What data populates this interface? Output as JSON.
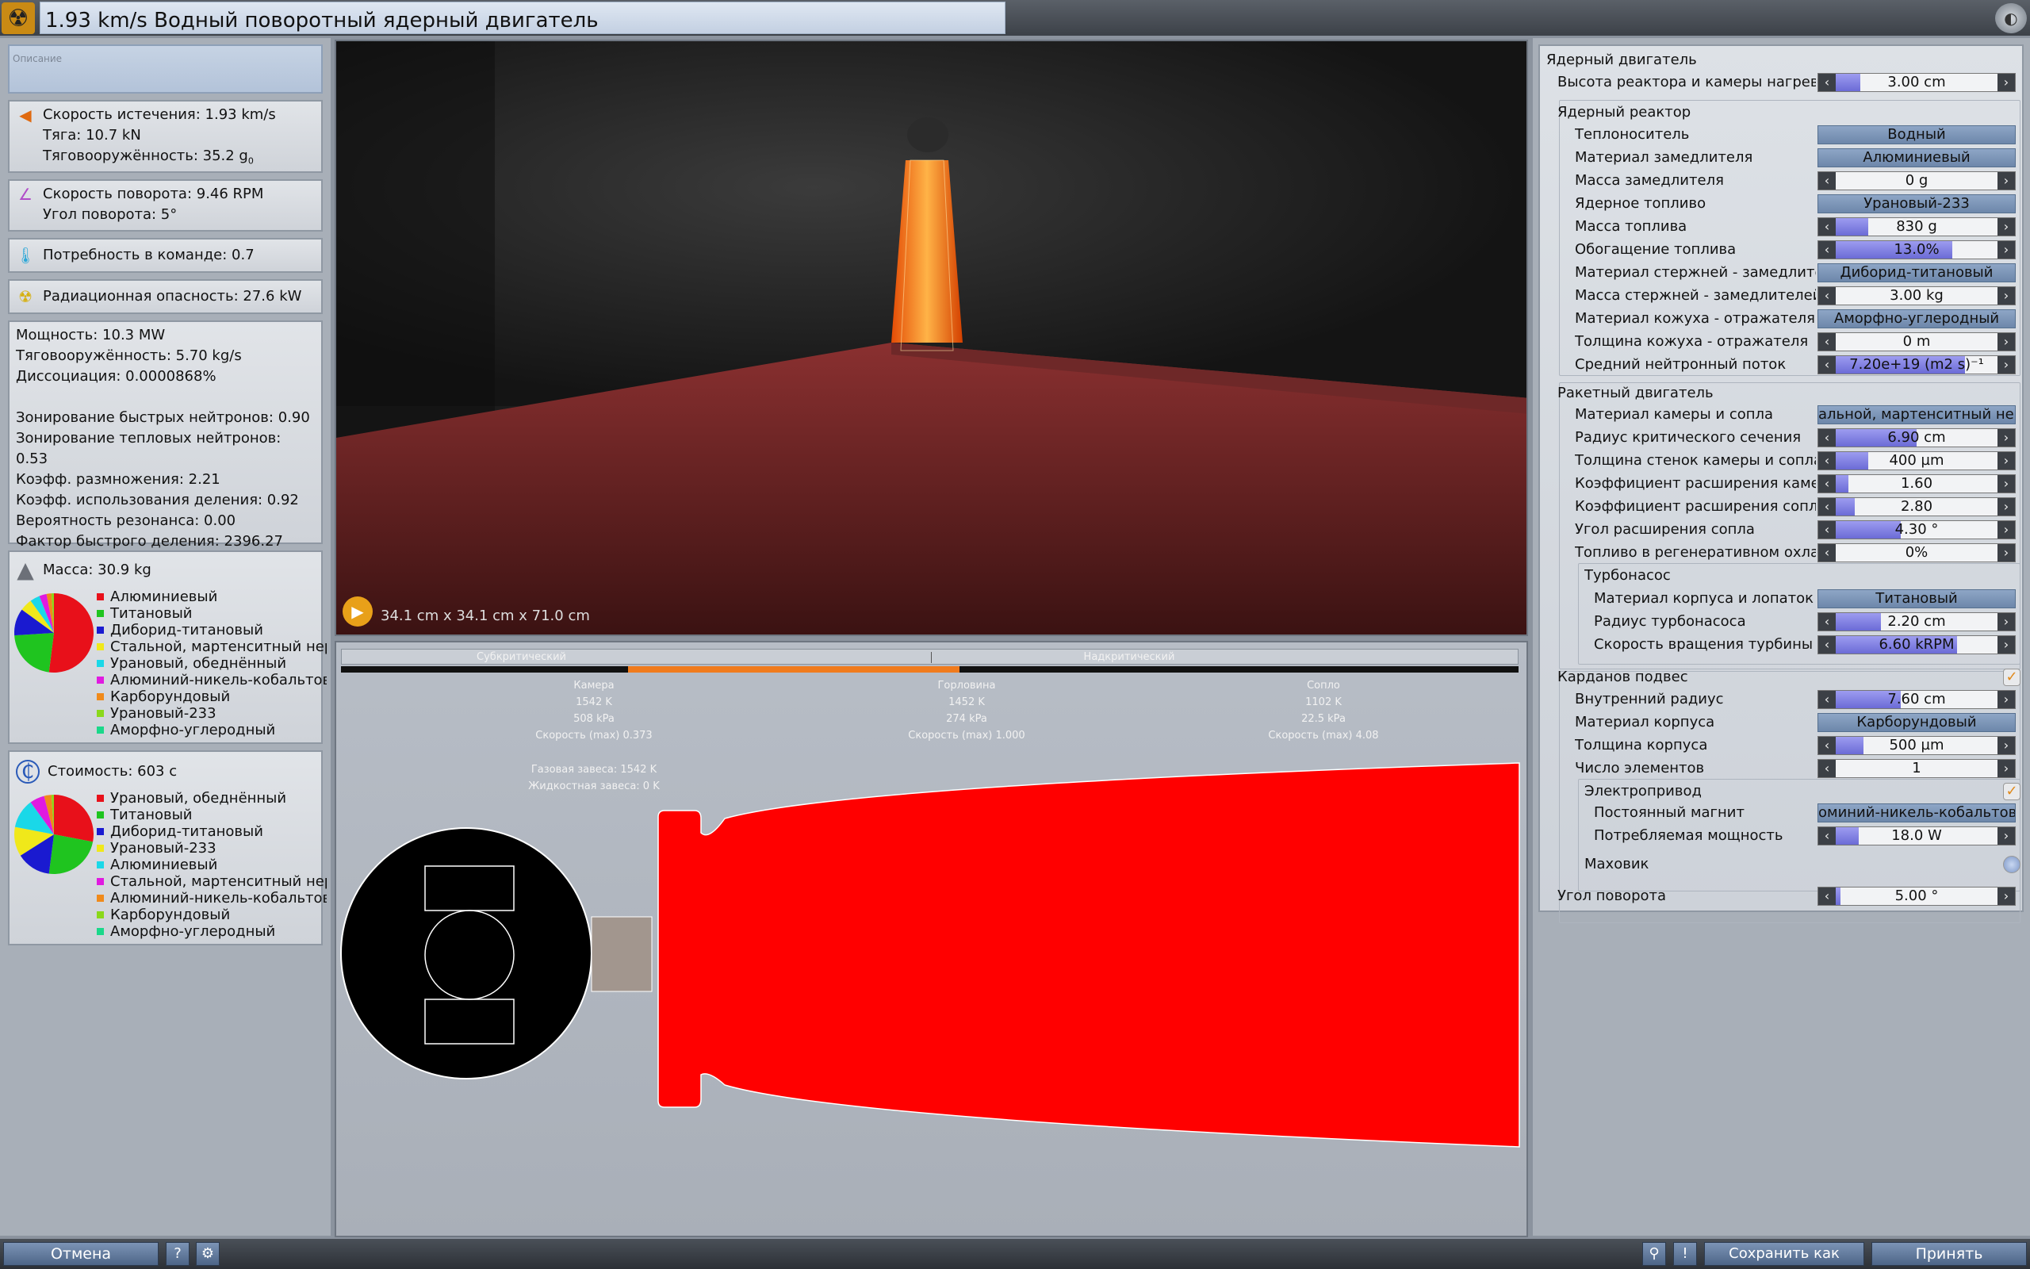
{
  "window": {
    "title": "1.93 km/s Водный поворотный ядерный двигатель"
  },
  "left": {
    "description_placeholder": "Описание",
    "exhaust": "Скорость истечения: 1.93 km/s",
    "thrust": "Тяга: 10.7 kN",
    "twr": "Тяговооружённость: 35.2 g",
    "twr_sub": "0",
    "gimbal_speed": "Скорость поворота: 9.46 RPM",
    "gimbal_angle": "Угол поворота: 5°",
    "crew": "Потребность в команде: 0.7",
    "radiation": "Радиационная опасность: 27.6 kW",
    "reactor_stats": [
      "Мощность: 10.3 MW",
      "Тяговооружённость: 5.70 kg/s",
      "Диссоциация: 0.0000868%",
      "",
      "Зонирование быстрых нейтронов: 0.90",
      "Зонирование тепловых нейтронов: 0.53",
      "Коэфф. размножения: 2.21",
      "Коэфф. использования деления: 0.92",
      "Вероятность резонанса: 0.00",
      "Фактор быстрого деления: 2396.27"
    ],
    "mass_label": "Масса: 30.9 kg",
    "mass_legend": [
      {
        "label": "Алюминиевый",
        "color": "#e8101a"
      },
      {
        "label": "Титановый",
        "color": "#1fc41f"
      },
      {
        "label": "Диборид-титановый",
        "color": "#1a1ad0"
      },
      {
        "label": "Стальной, мартенситный нерж",
        "color": "#f0e81a"
      },
      {
        "label": "Урановый, обеднённый",
        "color": "#1ad8e8"
      },
      {
        "label": "Алюминий-никель-кобальтовый",
        "color": "#e01ae0"
      },
      {
        "label": "Карборундовый",
        "color": "#f08a1a"
      },
      {
        "label": "Урановый-233",
        "color": "#8ad81a"
      },
      {
        "label": "Аморфно-углеродный",
        "color": "#1ad88a"
      }
    ],
    "mass_pie": [
      0.52,
      0.22,
      0.11,
      0.05,
      0.04,
      0.03,
      0.02,
      0.01
    ],
    "cost_label": "Стоимость: 603 с",
    "cost_legend": [
      {
        "label": "Урановый, обеднённый",
        "color": "#e8101a"
      },
      {
        "label": "Титановый",
        "color": "#1fc41f"
      },
      {
        "label": "Диборид-титановый",
        "color": "#1a1ad0"
      },
      {
        "label": "Урановый-233",
        "color": "#f0e81a"
      },
      {
        "label": "Алюминиевый",
        "color": "#1ad8e8"
      },
      {
        "label": "Стальной, мартенситный нерж",
        "color": "#e01ae0"
      },
      {
        "label": "Алюминий-никель-кобальтовый",
        "color": "#f08a1a"
      },
      {
        "label": "Карборундовый",
        "color": "#8ad81a"
      },
      {
        "label": "Аморфно-углеродный",
        "color": "#1ad88a"
      }
    ],
    "cost_pie": [
      0.28,
      0.24,
      0.14,
      0.12,
      0.12,
      0.06,
      0.03,
      0.01
    ]
  },
  "viewport": {
    "dimensions": "34.1 cm x 34.1 cm x 71.0 cm"
  },
  "diagram": {
    "subcritical": "Субкритический",
    "supercritical": "Надкритический",
    "chamber": {
      "title": "Камера",
      "temp": "1542 K",
      "pressure": "508 kPa",
      "speed": "Скорость (max) 0.373"
    },
    "throat": {
      "title": "Горловина",
      "temp": "1452 K",
      "pressure": "274 kPa",
      "speed": "Скорость (max) 1.000"
    },
    "nozzle": {
      "title": "Сопло",
      "temp": "1102 K",
      "pressure": "22.5 kPa",
      "speed": "Скорость (max) 4.08"
    },
    "gas_curtain": "Газовая завеса: 1542 K",
    "liquid_curtain": "Жидкостная завеса: 0 K"
  },
  "right": {
    "nuclear_engine": "Ядерный двигатель",
    "reactor_height_label": "Высота реактора и камеры нагрева",
    "reactor_height": "3.00 cm",
    "reactor": "Ядерный реактор",
    "coolant_label": "Теплоноситель",
    "coolant": "Водный",
    "moderator_label": "Материал замедлителя",
    "moderator": "Алюминиевый",
    "moderator_mass_label": "Масса замедлителя",
    "moderator_mass": "0 g",
    "fuel_label": "Ядерное топливо",
    "fuel": "Урановый-233",
    "fuel_mass_label": "Масса топлива",
    "fuel_mass": "830 g",
    "enrichment_label": "Обогащение топлива",
    "enrichment": "13.0%",
    "rod_material_label": "Материал стержней - замедлителей",
    "rod_material": "Диборид-титановый",
    "rod_mass_label": "Масса стержней - замедлителей",
    "rod_mass": "3.00 kg",
    "reflector_label": "Материал кожуха - отражателя",
    "reflector": "Аморфно-углеродный",
    "reflector_thick_label": "Толщина кожуха - отражателя",
    "reflector_thick": "0 m",
    "flux_label": "Средний нейтронный поток",
    "flux": "7.20e+19 (m2 s)⁻¹",
    "rocket": "Ракетный двигатель",
    "chamber_mat_label": "Материал камеры и сопла",
    "chamber_mat": "альной, мартенситный нерж",
    "throat_radius_label": "Радиус критического сечения",
    "throat_radius": "6.90 cm",
    "wall_label": "Толщина стенок камеры и сопла",
    "wall": "400 µm",
    "chamber_exp_label": "Коэффициент расширения камеры",
    "chamber_exp": "1.60",
    "nozzle_exp_label": "Коэффициент расширения сопла",
    "nozzle_exp": "2.80",
    "nozzle_angle_label": "Угол расширения сопла",
    "nozzle_angle": "4.30 °",
    "regen_label": "Топливо в регенеративном охлаждении",
    "regen": "0%",
    "turbopump": "Турбонасос",
    "tp_mat_label": "Материал корпуса и лопаток",
    "tp_mat": "Титановый",
    "tp_radius_label": "Радиус турбонасоса",
    "tp_radius": "2.20 cm",
    "tp_speed_label": "Скорость вращения турбины",
    "tp_speed": "6.60 kRPM",
    "gimbal": "Карданов подвес",
    "inner_radius_label": "Внутренний радиус",
    "inner_radius": "7.60 cm",
    "housing_mat_label": "Материал корпуса",
    "housing_mat": "Карборундовый",
    "housing_thick_label": "Толщина корпуса",
    "housing_thick": "500 µm",
    "elements_label": "Число элементов",
    "elements": "1",
    "actuator": "Электропривод",
    "magnet_label": "Постоянный магнит",
    "magnet": "оминий-никель-кобальтовый",
    "power_label": "Потребляемая мощность",
    "power": "18.0 W",
    "flywheel": "Маховик",
    "angle_label": "Угол поворота",
    "angle": "5.00 °"
  },
  "bottom": {
    "cancel": "Отмена",
    "help": "?",
    "save_copy": "Сохранить как копию",
    "accept": "Принять"
  }
}
